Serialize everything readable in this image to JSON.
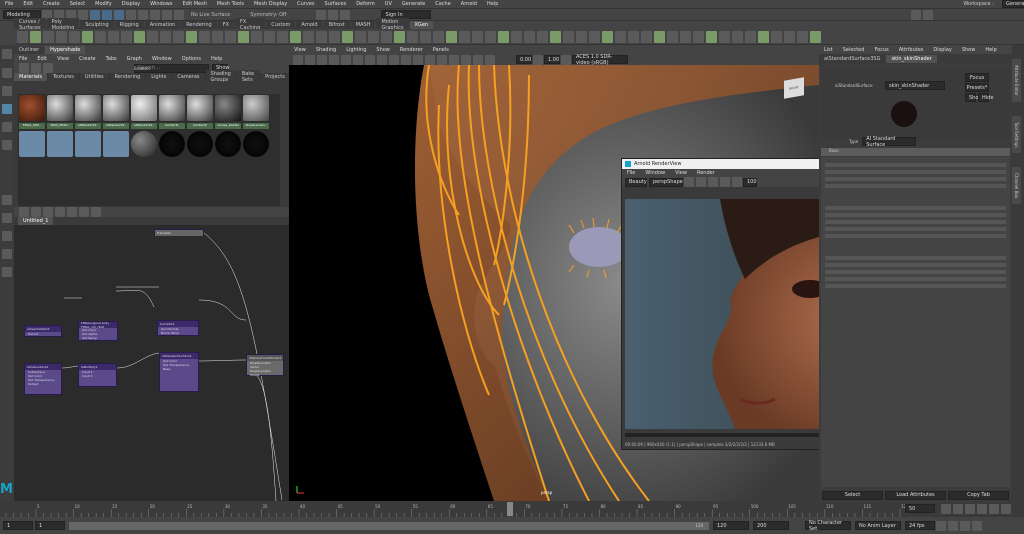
{
  "menubar": {
    "items": [
      "File",
      "Edit",
      "Create",
      "Select",
      "Modify",
      "Display",
      "Windows",
      "Edit Mesh",
      "Mesh Tools",
      "Mesh Display",
      "Curves",
      "Surfaces",
      "Deform",
      "UV",
      "Generate",
      "Cache",
      "Arnold",
      "Help"
    ],
    "workspace_label": "Workspace :",
    "workspace_value": "General*"
  },
  "statusline": {
    "mode": "Modeling",
    "live_surface": "No Live Surface",
    "symmetry": "Symmetry: Off",
    "sign_in": "Sign In"
  },
  "shelf_tabs": [
    "Curves / Surfaces",
    "Poly Modeling",
    "Sculpting",
    "Rigging",
    "Animation",
    "Rendering",
    "FX",
    "FX Caching",
    "Custom",
    "Arnold",
    "Bifrost",
    "MASH",
    "Motion Graphics",
    "XGen"
  ],
  "hypershade": {
    "tabs": [
      "Outliner",
      "Hypershade"
    ],
    "menu": [
      "File",
      "Edit",
      "View",
      "Create",
      "Tabs",
      "Graph",
      "Window",
      "Options",
      "Help"
    ],
    "browser_label": "Browser",
    "search_placeholder": "Search...",
    "show": "Show",
    "browser_tabs": [
      "Materials",
      "Textures",
      "Utilities",
      "Rendering",
      "Lights",
      "Cameras",
      "Shading Groups",
      "Bake Sets",
      "Projects",
      "Asset Nodes"
    ],
    "swatch_labels": [
      "FINAL_SHA..",
      "SKIN_SHAD..",
      "aiStandardS..",
      "aiStandardS..",
      "aiStandardS..",
      "lambert1",
      "lambert2",
      "cornea_shader",
      "displacemen.."
    ],
    "graph_tab": "Untitled_1"
  },
  "nodes": {
    "n1": "aiUserDataInt2",
    "n1r": [
      "Out Int"
    ],
    "n2": "FINALoriginal body FINAL_old_cDef",
    "n2r": [
      "Out Color",
      "Out Alpha",
      "Out Ramp"
    ],
    "n3": "bump2d1",
    "n3r": [
      "Out Normal",
      "Bump Value"
    ],
    "n4": "aiSubsurface1",
    "n4r": [
      "Subsurface",
      "Out Color",
      "Out Transparency",
      "Output"
    ],
    "n5": "aiMultiply1",
    "n5r": [
      "Input 1",
      "Input 2"
    ],
    "n6": "aiStandardSurface1",
    "n6r": [
      "Out Color",
      "Out Transparency",
      "Base"
    ],
    "n7": "displacementShader1",
    "n7r": [
      "Displacement",
      "Vector Displacement",
      "Shape"
    ],
    "n8": "Translate"
  },
  "viewport": {
    "menu": [
      "View",
      "Shading",
      "Lighting",
      "Show",
      "Renderer",
      "Panels"
    ],
    "field1": "0.00",
    "field2": "1.00",
    "colorspace": "ACES 1.0 SDR-video (sRGB)",
    "camera": "persp",
    "view_cube": "RIGHT"
  },
  "renderview": {
    "title": "Arnold RenderView",
    "menu": [
      "File",
      "Window",
      "View",
      "Render"
    ],
    "channel": "Beauty",
    "camera": "perspShape",
    "zoom": "100",
    "status": "00:00:09 | 960x540 (1:1) | perspShape | samples 3/2/2/2/2/2 | 12133.6 MB"
  },
  "attr_editor": {
    "menu": [
      "List",
      "Selected",
      "Focus",
      "Attributes",
      "Display",
      "Show",
      "Help"
    ],
    "tabs": [
      "aiStandardSurface3SG",
      "skin_skinShader"
    ],
    "node_label": "aiStandardSurface:",
    "node_value": "skin_skinShader",
    "focus": "Focus",
    "presets": "Presets*",
    "show": "Show",
    "hide": "Hide",
    "type_label": "Type",
    "type_value": "AI Standard Surface",
    "section": "Base",
    "bottom_buttons": [
      "Select",
      "Load Attributes",
      "Copy Tab"
    ],
    "side_tabs": [
      "Attribute Editor",
      "Tool Settings",
      "Channel Box"
    ]
  },
  "timeline": {
    "ticks": [
      "5",
      "10",
      "15",
      "20",
      "25",
      "30",
      "35",
      "40",
      "45",
      "50",
      "55",
      "60",
      "65",
      "70",
      "75",
      "80",
      "85",
      "90",
      "95",
      "100",
      "105",
      "110",
      "115",
      "120"
    ],
    "current_frame": "50",
    "start": "1",
    "range_start": "1",
    "range_end": "120",
    "end1": "120",
    "end2": "200",
    "fps": "24 fps",
    "char_set": "No Character Set",
    "anim_layer": "No Anim Layer"
  },
  "colors": {
    "accent": "#5285a6",
    "guide": "#f5a020",
    "node": "#5a4a8a"
  }
}
